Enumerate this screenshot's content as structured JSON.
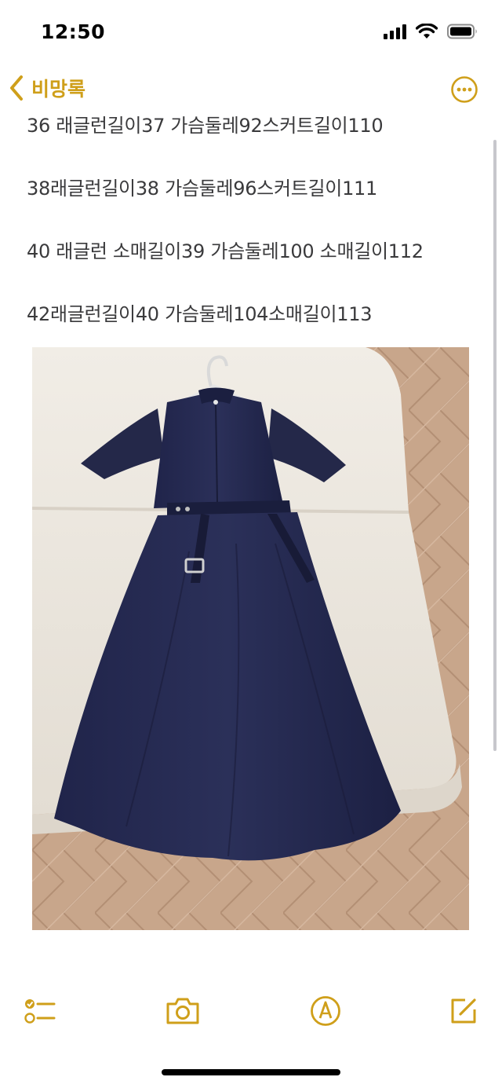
{
  "status_bar": {
    "time": "12:50",
    "icons": [
      "cellular-signal-icon",
      "wifi-icon",
      "battery-icon"
    ]
  },
  "nav": {
    "back_label": "비망록",
    "back_icon": "chevron-left-icon",
    "more_icon": "ellipsis-circle-icon"
  },
  "note": {
    "lines": [
      "36 래글런길이37 가슴둘레92스커트길이110",
      "38래글런길이38 가슴둘레96스커트길이111",
      "40 래글런 소매길이39 가슴둘레100 소매길이112",
      "42래글런길이40 가슴둘레104소매길이113"
    ]
  },
  "photo": {
    "subject": "navy-dress-photo"
  },
  "toolbar": {
    "items": [
      "checklist-icon",
      "camera-icon",
      "markup-pen-icon",
      "compose-icon"
    ]
  },
  "colors": {
    "accent": "#cf9f1a",
    "text": "#3a3a3c",
    "dress": "#24284a"
  }
}
